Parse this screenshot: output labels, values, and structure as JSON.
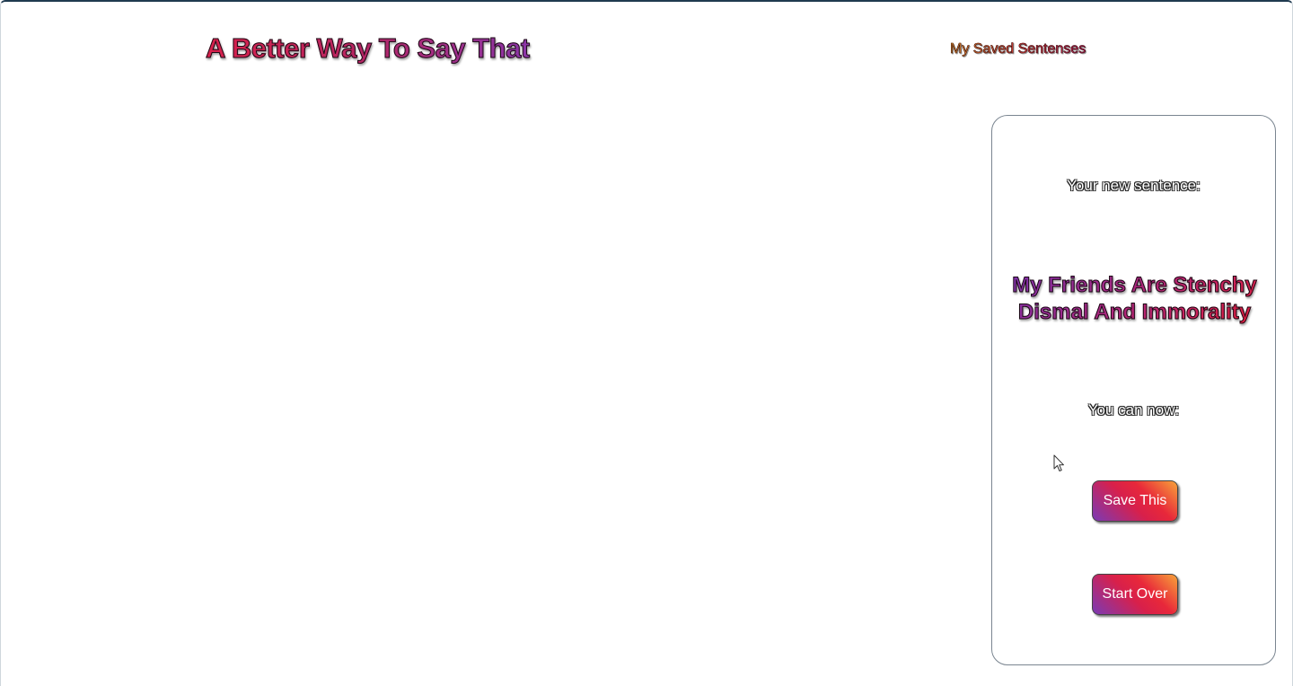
{
  "header": {
    "app_title": "A Better Way To Say That",
    "nav_saved_label": "My Saved Sentenses"
  },
  "result_card": {
    "new_sentence_label": "Your new sentence:",
    "new_sentence": "My Friends Are Stenchy Dismal And Immorality",
    "next_actions_label": "You can now:",
    "save_button_label": "Save This",
    "start_over_button_label": "Start Over"
  },
  "colors": {
    "title_gradient_start": "#d8204b",
    "title_gradient_end": "#8a35a8",
    "button_gradient_purple": "#7a3ab5",
    "button_gradient_red": "#e8283a",
    "button_gradient_orange": "#f7a33a",
    "card_border": "#7a8590"
  },
  "icons": {
    "pointer": "mouse-pointer-icon"
  }
}
